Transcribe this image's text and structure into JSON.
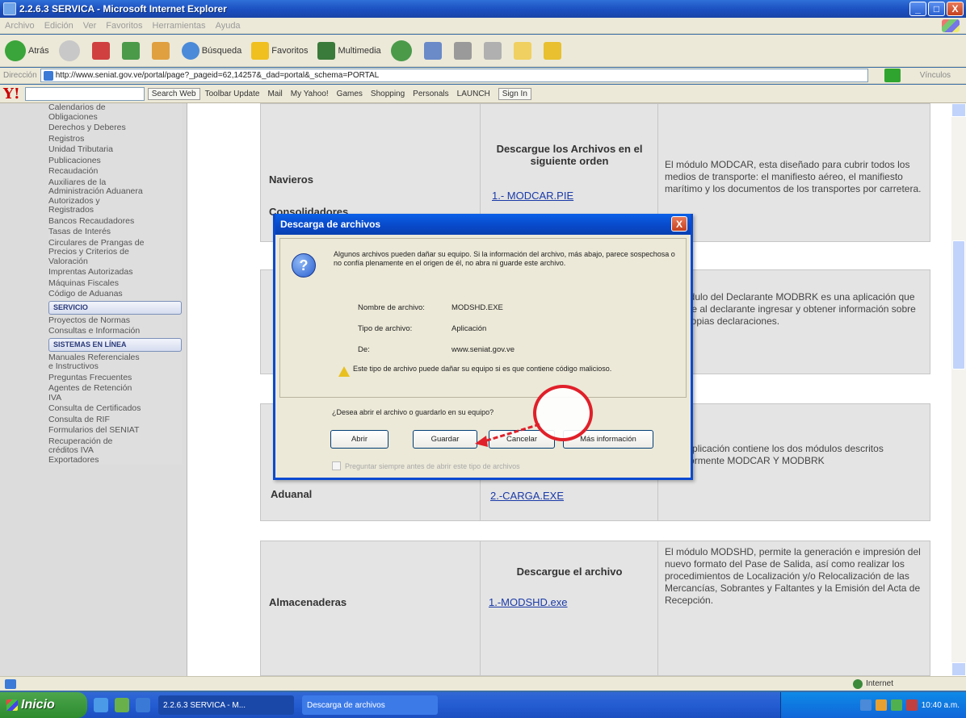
{
  "window": {
    "title": "2.2.6.3 SERVICA - Microsoft Internet Explorer",
    "minimize": "_",
    "maximize": "□",
    "close": "X"
  },
  "menubar": [
    "Archivo",
    "Edición",
    "Ver",
    "Favoritos",
    "Herramientas",
    "Ayuda"
  ],
  "toolbar": {
    "back": "Atrás",
    "search": "Búsqueda",
    "favorites": "Favoritos",
    "multimedia": "Multimedia"
  },
  "address": {
    "label": "Dirección",
    "url": "http://www.seniat.gov.ve/portal/page?_pageid=62,14257&_dad=portal&_schema=PORTAL",
    "links": "Vínculos"
  },
  "yahoo_toolbar": {
    "search_button": "Search Web",
    "toolbar_update": "Toolbar Update",
    "items": [
      "Mail",
      "My Yahoo!",
      "Games",
      "Shopping",
      "Personals",
      "LAUNCH"
    ],
    "sign_in": "Sign In"
  },
  "sidebar": {
    "links_top": [
      "Calendarios de",
      "Obligaciones",
      "Derechos y Deberes",
      "Registros",
      "Unidad Tributaria",
      "Publicaciones",
      "Recaudación",
      "Auxiliares de la",
      "Administración Aduanera",
      "Autorizados y",
      "Registrados",
      "Bancos Recaudadores",
      "Tasas de Interés",
      "Circulares de Prangas de",
      "Precios y Criterios de",
      "Valoración",
      "Imprentas Autorizadas",
      "Máquinas Fiscales",
      "Código de Aduanas"
    ],
    "header_servicio": "SERVICIO",
    "links_mid": [
      "Proyectos de Normas",
      "Consultas e Información"
    ],
    "header_sistemas": "SISTEMAS EN LÍNEA",
    "links_bottom": [
      "Manuales Referenciales",
      "e Instructivos",
      "Preguntas Frecuentes",
      "Agentes de Retención",
      "IVA",
      "Consulta de Certificados",
      "Consulta de RIF",
      "Formularios del SENIAT",
      "Recuperación de",
      "créditos IVA",
      "Exportadores"
    ]
  },
  "table": {
    "row1": {
      "label": "Navieros",
      "label2": "Consolidadores",
      "download_head": "Descargue los Archivos en el siguiente orden",
      "link1": "1.- MODCAR.PIE",
      "desc": "El módulo MODCAR, esta diseñado para cubrir todos los medios de transporte: el manifiesto aéreo, el manifiesto marítimo y los documentos de los transportes por carretera."
    },
    "row2": {
      "desc": "El módulo del Declarante MODBRK es una aplicación que permite al declarante ingresar y obtener información sobre sus propias declaraciones."
    },
    "row3": {
      "label": "Aduanal",
      "link": "2.-CARGA.EXE",
      "desc": "Esta aplicación contiene los dos módulos descritos anteriormente MODCAR Y MODBRK"
    },
    "row4": {
      "label": "Almacenaderas",
      "download_head": "Descargue el archivo",
      "link": "1.-MODSHD.exe",
      "desc": "El módulo MODSHD, permite la generación e impresión del nuevo formato del Pase de Salida, así como realizar los procedimientos de Localización y/o Relocalización de las Mercancías, Sobrantes y Faltantes y la Emisión del Acta de Recepción."
    }
  },
  "dialog": {
    "title": "Descarga de archivos",
    "close": "X",
    "icon": "?",
    "warning": "Algunos archivos pueden dañar su equipo. Si la información del archivo, más abajo, parece sospechosa o no confía plenamente en el origen de él, no abra ni guarde este archivo.",
    "fields": [
      {
        "label": "Nombre de archivo:",
        "value": "MODSHD.EXE"
      },
      {
        "label": "Tipo de archivo:",
        "value": "Aplicación"
      },
      {
        "label": "De:",
        "value": "www.seniat.gov.ve"
      }
    ],
    "warning2": "Este tipo de archivo puede dañar su equipo si es que contiene código malicioso.",
    "question": "¿Desea abrir el archivo o guardarlo en su equipo?",
    "buttons": {
      "open": "Abrir",
      "save": "Guardar",
      "cancel": "Cancelar",
      "more_info": "Más información"
    },
    "checkbox": "Preguntar siempre antes de abrir este tipo de archivos"
  },
  "statusbar": {
    "zone": "Internet"
  },
  "taskbar": {
    "start": "Inicio",
    "tasks": [
      "2.2.6.3 SERVICA - M...",
      "Descarga de archivos"
    ],
    "clock": "10:40 a.m."
  },
  "colors": {
    "xp_blue": "#0a4ad0",
    "link_blue": "#1a3aa8",
    "annotation_red": "#e0202a",
    "start_green": "#2e8b2e"
  }
}
